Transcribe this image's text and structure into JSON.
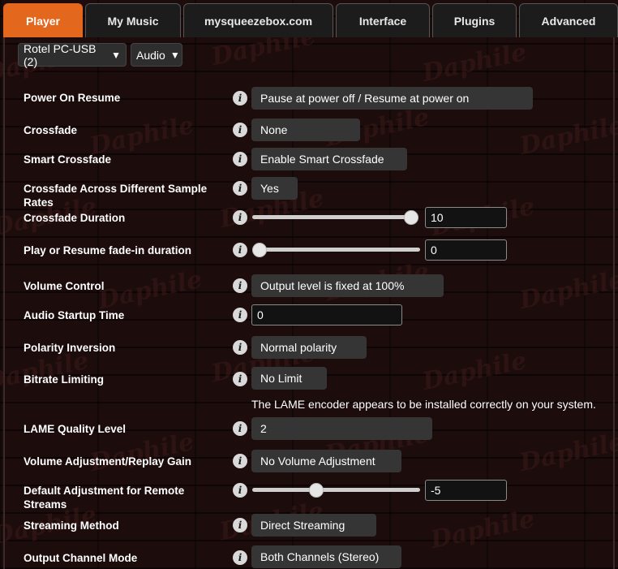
{
  "tabs": [
    {
      "label": "Player",
      "active": true
    },
    {
      "label": "My Music",
      "active": false
    },
    {
      "label": "mysqueezebox.com",
      "active": false
    },
    {
      "label": "Interface",
      "active": false
    },
    {
      "label": "Plugins",
      "active": false
    },
    {
      "label": "Advanced",
      "active": false
    }
  ],
  "player_select": {
    "value": "Rotel PC-USB (2)",
    "arrow": "▼"
  },
  "section_select": {
    "value": "Audio",
    "arrow": "▼"
  },
  "watermark": "Daphile",
  "info_glyph": "i",
  "settings": {
    "power_on_resume": {
      "label": "Power On Resume",
      "value": "Pause at power off / Resume at power on"
    },
    "crossfade": {
      "label": "Crossfade",
      "value": "None"
    },
    "smart_crossfade": {
      "label": "Smart Crossfade",
      "value": "Enable Smart Crossfade"
    },
    "crossfade_sample_rates": {
      "label": "Crossfade Across Different Sample Rates",
      "value": "Yes"
    },
    "crossfade_duration": {
      "label": "Crossfade Duration",
      "value": "10",
      "slider_fraction": 1.0
    },
    "fadein_duration": {
      "label": "Play or Resume fade-in duration",
      "value": "0",
      "slider_fraction": 0.0
    },
    "volume_control": {
      "label": "Volume Control",
      "value": "Output level is fixed at 100%"
    },
    "audio_startup_time": {
      "label": "Audio Startup Time",
      "value": "0"
    },
    "polarity_inversion": {
      "label": "Polarity Inversion",
      "value": "Normal polarity"
    },
    "bitrate_limiting": {
      "label": "Bitrate Limiting",
      "value": "No Limit"
    },
    "lame_note": "The LAME encoder appears to be installed correctly on your system.",
    "lame_quality": {
      "label": "LAME Quality Level",
      "value": "2"
    },
    "volume_adjustment": {
      "label": "Volume Adjustment/Replay Gain",
      "value": "No Volume Adjustment"
    },
    "default_adjustment": {
      "label": "Default Adjustment for Remote Streams",
      "value": "-5",
      "slider_fraction": 0.4
    },
    "streaming_method": {
      "label": "Streaming Method",
      "value": "Direct Streaming"
    },
    "output_channel_mode": {
      "label": "Output Channel Mode",
      "value": "Both Channels (Stereo)"
    }
  },
  "colors": {
    "accent": "#e4671e",
    "background": "#1d0c0c",
    "control": "#353535"
  }
}
